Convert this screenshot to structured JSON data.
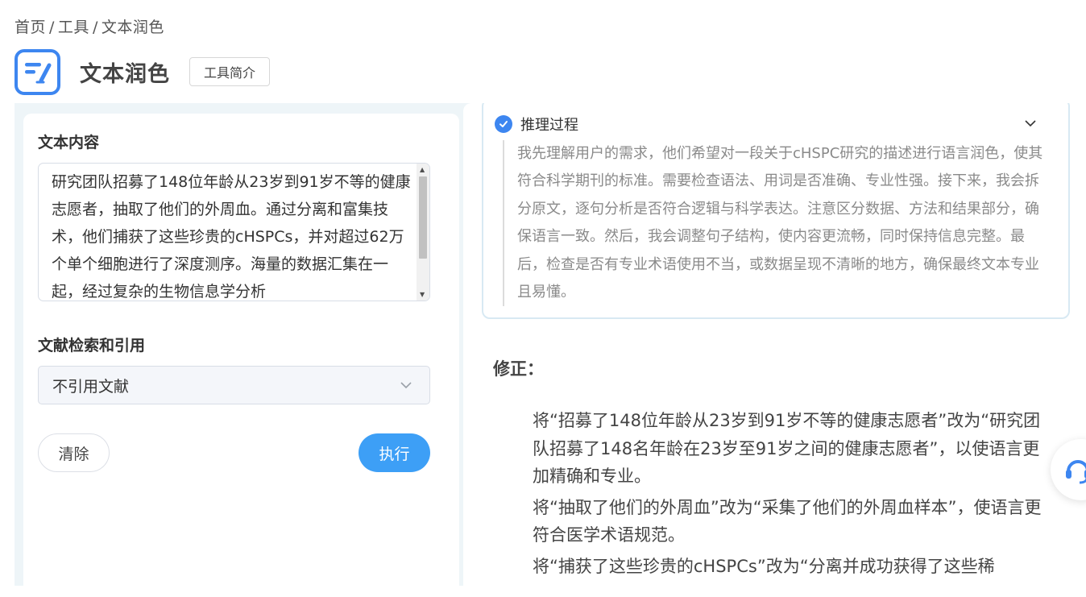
{
  "breadcrumb": {
    "home": "首页",
    "tools": "工具",
    "current": "文本润色",
    "sep": "/"
  },
  "header": {
    "title": "文本润色",
    "intro_button": "工具简介"
  },
  "left": {
    "content_label": "文本内容",
    "content_text": "研究团队招募了148位年龄从23岁到91岁不等的健康志愿者，抽取了他们的外周血。通过分离和富集技术，他们捕获了这些珍贵的cHSPCs，并对超过62万个单个细胞进行了深度测序。海量的数据汇集在一起，经过复杂的生物信息学分析",
    "citation_label": "文献检索和引用",
    "citation_selected": "不引用文献",
    "clear_button": "清除",
    "run_button": "执行"
  },
  "right": {
    "reasoning_title": "推理过程",
    "reasoning_text": "我先理解用户的需求，他们希望对一段关于cHSPC研究的描述进行语言润色，使其符合科学期刊的标准。需要检查语法、用词是否准确、专业性强。接下来，我会拆分原文，逐句分析是否符合逻辑与科学表达。注意区分数据、方法和结果部分，确保语言一致。然后，我会调整句子结构，使内容更流畅，同时保持信息完整。最后，检查是否有专业术语使用不当，或数据呈现不清晰的地方，确保最终文本专业且易懂。",
    "fix_title": "修正：",
    "fixes": [
      "将“招募了148位年龄从23岁到91岁不等的健康志愿者”改为“研究团队招募了148名年龄在23岁至91岁之间的健康志愿者”，以使语言更加精确和专业。",
      "将“抽取了他们的外周血”改为“采集了他们的外周血样本”，使语言更符合医学术语规范。",
      "将“捕获了这些珍贵的cHSPCs”改为“分离并成功获得了这些稀"
    ]
  },
  "colors": {
    "accent": "#3d86f0",
    "button_primary": "#3d9ff6",
    "workspace_bg": "#eef5f8"
  },
  "icons": {
    "logo": "edit-text-icon",
    "check": "check-circle-icon",
    "chevron": "chevron-down-icon",
    "help": "customer-service-icon"
  }
}
